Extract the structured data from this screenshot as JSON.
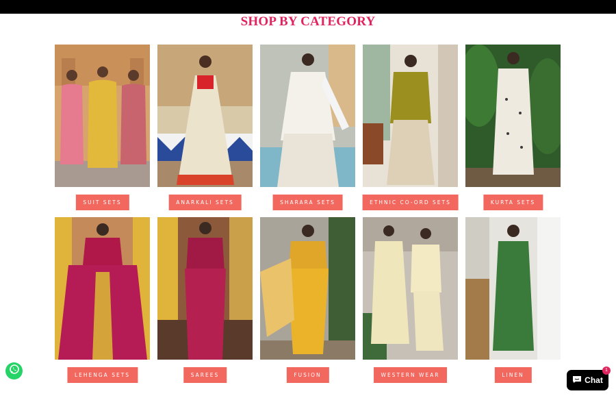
{
  "header": {
    "title": "SHOP BY CATEGORY"
  },
  "categories": [
    {
      "label": "SUIT SETS"
    },
    {
      "label": "ANARKALI SETS"
    },
    {
      "label": "SHARARA SETS"
    },
    {
      "label": "ETHNIC CO-ORD SETS"
    },
    {
      "label": "KURTA SETS"
    },
    {
      "label": "LEHENGA SETS"
    },
    {
      "label": "SAREES"
    },
    {
      "label": "FUSION"
    },
    {
      "label": "WESTERN WEAR"
    },
    {
      "label": "LINEN"
    }
  ],
  "chat": {
    "label": "Chat",
    "badge": "1"
  },
  "icons": {
    "whatsapp": "whatsapp-icon",
    "chat": "chat-bubble-icon"
  },
  "colors": {
    "accent": "#e0245e",
    "button": "#f2685f"
  }
}
